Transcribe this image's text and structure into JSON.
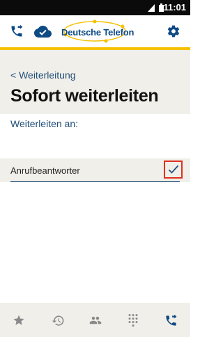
{
  "status_bar": {
    "time": "11:01"
  },
  "app_bar": {
    "brand": "Deutsche Telefon",
    "colors": {
      "brand_blue": "#0e4a84",
      "accent_yellow": "#f5c000"
    },
    "icons": {
      "left": "call-forward-icon",
      "cloud": "cloud-check-icon",
      "settings": "gear-icon"
    }
  },
  "header": {
    "breadcrumb": "< Weiterleitung",
    "title": "Sofort weiterleiten"
  },
  "content": {
    "section_label": "Weiterleiten an:",
    "option": {
      "label": "Anrufbeantworter",
      "checked": true
    }
  },
  "bottom_nav": {
    "items": [
      {
        "icon": "star-icon",
        "active": false
      },
      {
        "icon": "history-icon",
        "active": false
      },
      {
        "icon": "contacts-icon",
        "active": false
      },
      {
        "icon": "dialpad-icon",
        "active": false
      },
      {
        "icon": "call-forward-icon",
        "active": true
      }
    ]
  }
}
